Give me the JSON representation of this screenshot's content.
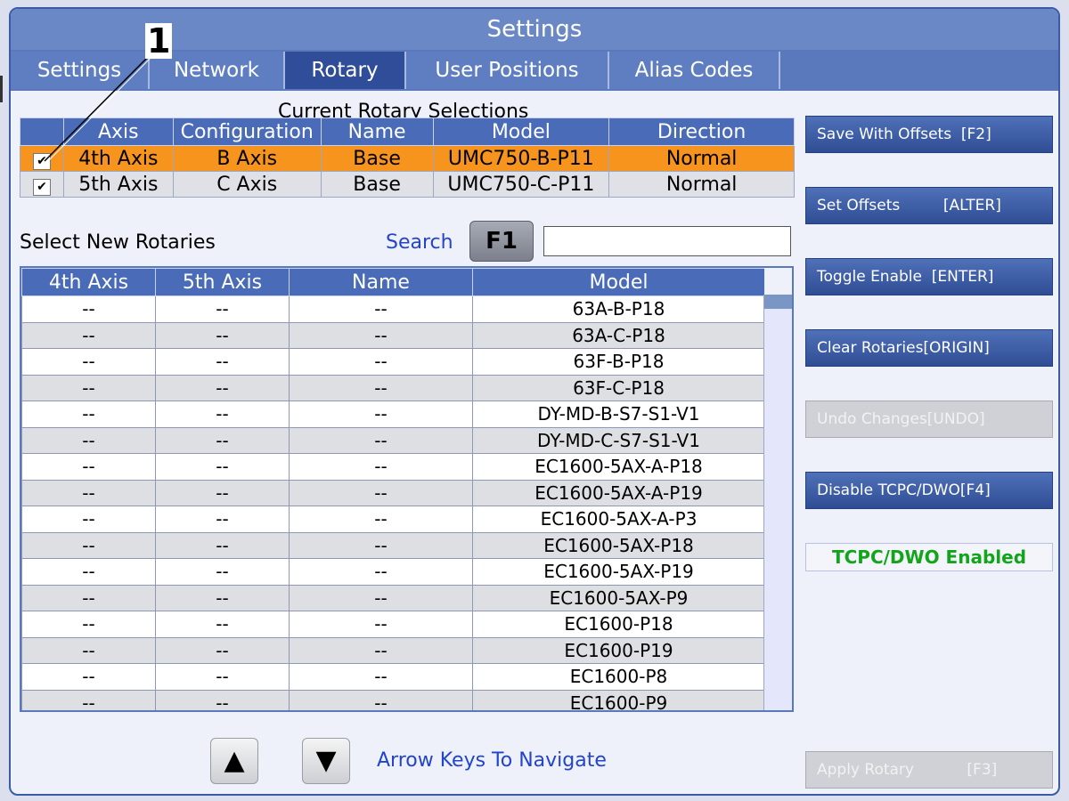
{
  "window": {
    "title": "Settings"
  },
  "callout": {
    "number": "1"
  },
  "tabs": [
    {
      "label": "Settings",
      "active": false
    },
    {
      "label": "Network",
      "active": false
    },
    {
      "label": "Rotary",
      "active": true
    },
    {
      "label": "User Positions",
      "active": false
    },
    {
      "label": "Alias Codes",
      "active": false
    }
  ],
  "current": {
    "caption": "Current Rotary Selections",
    "columns": [
      "",
      "Axis",
      "Configuration",
      "Name",
      "Model",
      "Direction"
    ],
    "rows": [
      {
        "check": "✔",
        "axis": "4th Axis",
        "configuration": "B Axis",
        "name": "Base",
        "model": "UMC750-B-P11",
        "direction": "Normal"
      },
      {
        "check": "✔",
        "axis": "5th Axis",
        "configuration": "C Axis",
        "name": "Base",
        "model": "UMC750-C-P11",
        "direction": "Normal"
      }
    ]
  },
  "search": {
    "section_label": "Select New Rotaries",
    "label": "Search",
    "key": "F1",
    "value": ""
  },
  "list": {
    "columns": [
      "4th Axis",
      "5th Axis",
      "Name",
      "Model"
    ],
    "rows": [
      [
        "--",
        "--",
        "--",
        "63A-B-P18"
      ],
      [
        "--",
        "--",
        "--",
        "63A-C-P18"
      ],
      [
        "--",
        "--",
        "--",
        "63F-B-P18"
      ],
      [
        "--",
        "--",
        "--",
        "63F-C-P18"
      ],
      [
        "--",
        "--",
        "--",
        "DY-MD-B-S7-S1-V1"
      ],
      [
        "--",
        "--",
        "--",
        "DY-MD-C-S7-S1-V1"
      ],
      [
        "--",
        "--",
        "--",
        "EC1600-5AX-A-P18"
      ],
      [
        "--",
        "--",
        "--",
        "EC1600-5AX-A-P19"
      ],
      [
        "--",
        "--",
        "--",
        "EC1600-5AX-A-P3"
      ],
      [
        "--",
        "--",
        "--",
        "EC1600-5AX-P18"
      ],
      [
        "--",
        "--",
        "--",
        "EC1600-5AX-P19"
      ],
      [
        "--",
        "--",
        "--",
        "EC1600-5AX-P9"
      ],
      [
        "--",
        "--",
        "--",
        "EC1600-P18"
      ],
      [
        "--",
        "--",
        "--",
        "EC1600-P19"
      ],
      [
        "--",
        "--",
        "--",
        "EC1600-P8"
      ],
      [
        "--",
        "--",
        "--",
        "EC1600-P9"
      ]
    ]
  },
  "side_buttons": {
    "save": "Save With Offsets  [F2]",
    "set_offsets": "Set Offsets         [ALTER]",
    "toggle": "Toggle Enable  [ENTER]",
    "clear": "Clear Rotaries[ORIGIN]",
    "undo": "Undo Changes[UNDO]",
    "disable_tcpc": "Disable TCPC/DWO[F4]",
    "apply": "Apply Rotary           [F3]"
  },
  "status": {
    "tcpc": "TCPC/DWO Enabled",
    "color": "#12a51b"
  },
  "navigation": {
    "hint": "Arrow Keys To Navigate",
    "up_icon": "up-triangle-icon",
    "down_icon": "down-triangle-icon"
  }
}
